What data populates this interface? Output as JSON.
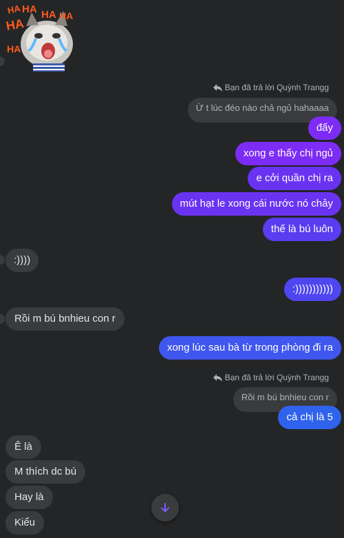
{
  "sticker": {
    "lettering": [
      "HA",
      "HA",
      "HA",
      "HA",
      "HA",
      "HA"
    ]
  },
  "reply1": {
    "header": "Bạn đã trả lời Quỳnh Trangg",
    "quoted": "Ừ t lúc đéo nào chả ngủ hahaaaa"
  },
  "outgoing1": [
    "đấy",
    "xong e thấy chị ngủ",
    "e cởi quần chị ra",
    "mút hạt le xong cái nước nó chảy",
    "thế là bú luôn"
  ],
  "incoming1": ":))))",
  "outgoing2": ":)))))))))))",
  "incoming2": "Rồi m bú bnhieu con r",
  "outgoing3": "xong lúc sau bà từ trong phòng đi ra",
  "reply2": {
    "header": "Bạn đã trả lời Quỳnh Trangg",
    "quoted": "Rồi m bú bnhieu con r"
  },
  "outgoing4": "cả chị là 5",
  "incoming3": [
    "Ê là",
    "M thích dc bú",
    "Hay là",
    "Kiểu"
  ],
  "icons": {
    "reply": "reply-arrow-icon",
    "scroll": "arrow-down-icon"
  },
  "colors": {
    "background": "#242526",
    "incoming_bubble": "#3a3b3c",
    "accent_purple": "#7d2cf5",
    "accent_blue": "#2f63ec"
  }
}
